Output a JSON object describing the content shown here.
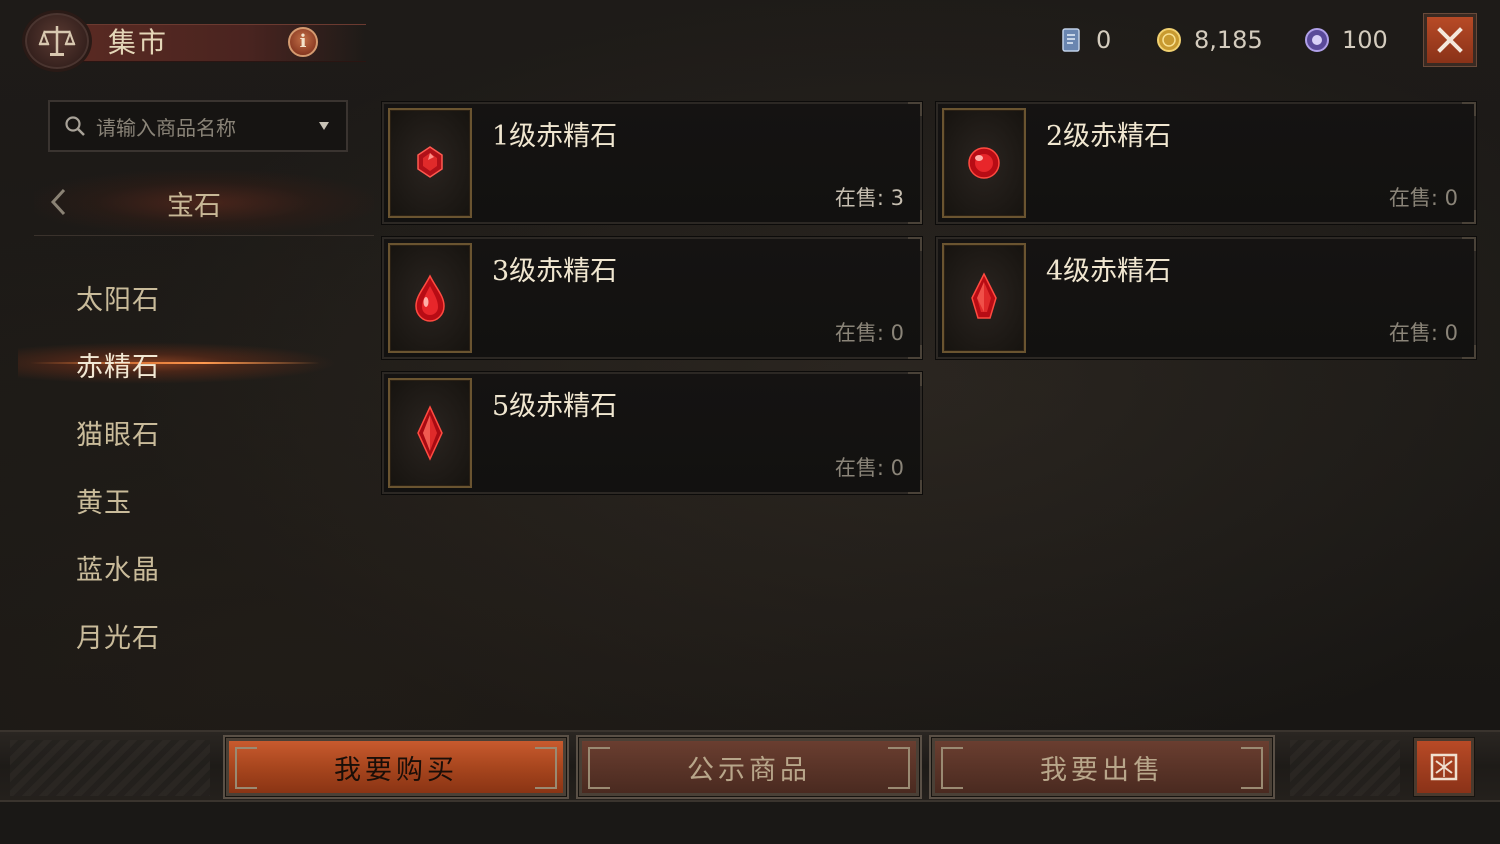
{
  "header": {
    "title": "集市",
    "info_label": "i",
    "currencies": [
      {
        "icon": "scroll-icon",
        "value": "0"
      },
      {
        "icon": "gold-coin-icon",
        "value": "8,185"
      },
      {
        "icon": "platinum-orb-icon",
        "value": "100"
      }
    ]
  },
  "search": {
    "placeholder": "请输入商品名称"
  },
  "category": {
    "title": "宝石",
    "subcategories": [
      {
        "label": "太阳石",
        "selected": false
      },
      {
        "label": "赤精石",
        "selected": true
      },
      {
        "label": "猫眼石",
        "selected": false
      },
      {
        "label": "黄玉",
        "selected": false
      },
      {
        "label": "蓝水晶",
        "selected": false
      },
      {
        "label": "月光石",
        "selected": false
      }
    ]
  },
  "items": [
    {
      "name": "1级赤精石",
      "on_sale_label": "在售:",
      "on_sale_count": "3"
    },
    {
      "name": "2级赤精石",
      "on_sale_label": "在售:",
      "on_sale_count": "0"
    },
    {
      "name": "3级赤精石",
      "on_sale_label": "在售:",
      "on_sale_count": "0"
    },
    {
      "name": "4级赤精石",
      "on_sale_label": "在售:",
      "on_sale_count": "0"
    },
    {
      "name": "5级赤精石",
      "on_sale_label": "在售:",
      "on_sale_count": "0"
    }
  ],
  "bottom": {
    "buy_label": "我要购买",
    "showcase_label": "公示商品",
    "sell_label": "我要出售"
  },
  "colors": {
    "accent": "#c85a2e",
    "gem": "#c8141e",
    "gold_text": "#f0e6d0"
  }
}
